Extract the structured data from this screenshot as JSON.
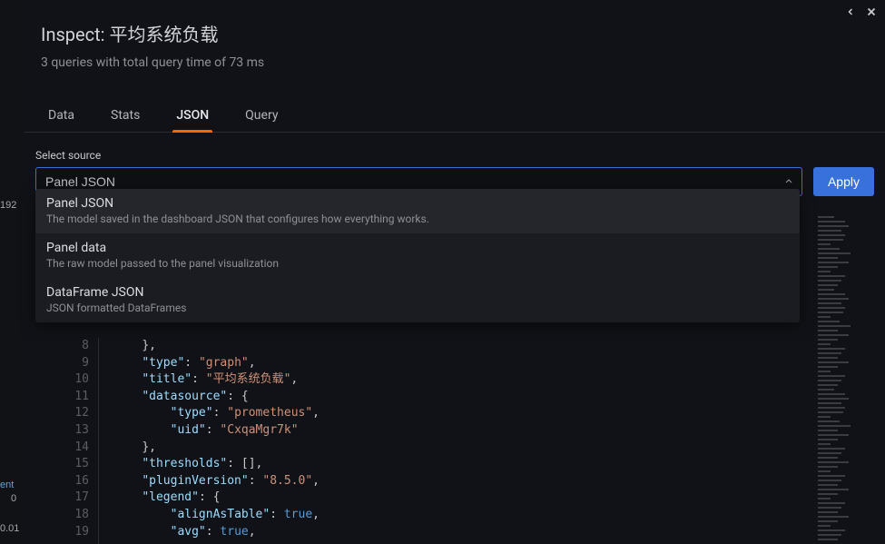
{
  "header": {
    "title_prefix": "Inspect: ",
    "title_name": "平均系统负载",
    "subtitle": "3 queries with total query time of 73 ms"
  },
  "tabs": [
    {
      "label": "Data",
      "active": false
    },
    {
      "label": "Stats",
      "active": false
    },
    {
      "label": "JSON",
      "active": true
    },
    {
      "label": "Query",
      "active": false
    }
  ],
  "source": {
    "label": "Select source",
    "value": "Panel JSON",
    "apply_label": "Apply"
  },
  "dropdown_options": [
    {
      "title": "Panel JSON",
      "desc": "The model saved in the dashboard JSON that configures how everything works.",
      "selected": true
    },
    {
      "title": "Panel data",
      "desc": "The raw model passed to the panel visualization",
      "selected": false
    },
    {
      "title": "DataFrame JSON",
      "desc": "JSON formatted DataFrames",
      "selected": false
    }
  ],
  "code_lines": [
    {
      "n": 8,
      "indent": 2,
      "tokens": [
        {
          "t": "punc",
          "v": "},"
        }
      ]
    },
    {
      "n": 9,
      "indent": 2,
      "tokens": [
        {
          "t": "key",
          "v": "\"type\""
        },
        {
          "t": "punc",
          "v": ": "
        },
        {
          "t": "str",
          "v": "\"graph\""
        },
        {
          "t": "punc",
          "v": ","
        }
      ]
    },
    {
      "n": 10,
      "indent": 2,
      "tokens": [
        {
          "t": "key",
          "v": "\"title\""
        },
        {
          "t": "punc",
          "v": ": "
        },
        {
          "t": "str",
          "v": "\"平均系统负载\""
        },
        {
          "t": "punc",
          "v": ","
        }
      ]
    },
    {
      "n": 11,
      "indent": 2,
      "tokens": [
        {
          "t": "key",
          "v": "\"datasource\""
        },
        {
          "t": "punc",
          "v": ": {"
        }
      ]
    },
    {
      "n": 12,
      "indent": 4,
      "tokens": [
        {
          "t": "key",
          "v": "\"type\""
        },
        {
          "t": "punc",
          "v": ": "
        },
        {
          "t": "str",
          "v": "\"prometheus\""
        },
        {
          "t": "punc",
          "v": ","
        }
      ]
    },
    {
      "n": 13,
      "indent": 4,
      "tokens": [
        {
          "t": "key",
          "v": "\"uid\""
        },
        {
          "t": "punc",
          "v": ": "
        },
        {
          "t": "str",
          "v": "\"CxqaMgr7k\""
        }
      ]
    },
    {
      "n": 14,
      "indent": 2,
      "tokens": [
        {
          "t": "punc",
          "v": "},"
        }
      ]
    },
    {
      "n": 15,
      "indent": 2,
      "tokens": [
        {
          "t": "key",
          "v": "\"thresholds\""
        },
        {
          "t": "punc",
          "v": ": [],"
        }
      ]
    },
    {
      "n": 16,
      "indent": 2,
      "tokens": [
        {
          "t": "key",
          "v": "\"pluginVersion\""
        },
        {
          "t": "punc",
          "v": ": "
        },
        {
          "t": "str",
          "v": "\"8.5.0\""
        },
        {
          "t": "punc",
          "v": ","
        }
      ]
    },
    {
      "n": 17,
      "indent": 2,
      "tokens": [
        {
          "t": "key",
          "v": "\"legend\""
        },
        {
          "t": "punc",
          "v": ": {"
        }
      ]
    },
    {
      "n": 18,
      "indent": 4,
      "tokens": [
        {
          "t": "key",
          "v": "\"alignAsTable\""
        },
        {
          "t": "punc",
          "v": ": "
        },
        {
          "t": "bool",
          "v": "true"
        },
        {
          "t": "punc",
          "v": ","
        }
      ]
    },
    {
      "n": 19,
      "indent": 4,
      "tokens": [
        {
          "t": "key",
          "v": "\"avg\""
        },
        {
          "t": "punc",
          "v": ": "
        },
        {
          "t": "bool",
          "v": "true"
        },
        {
          "t": "punc",
          "v": ","
        }
      ]
    }
  ],
  "backdrop": {
    "v192": "192",
    "vent": "ent",
    "v0": "0",
    "v001": "0.01"
  }
}
